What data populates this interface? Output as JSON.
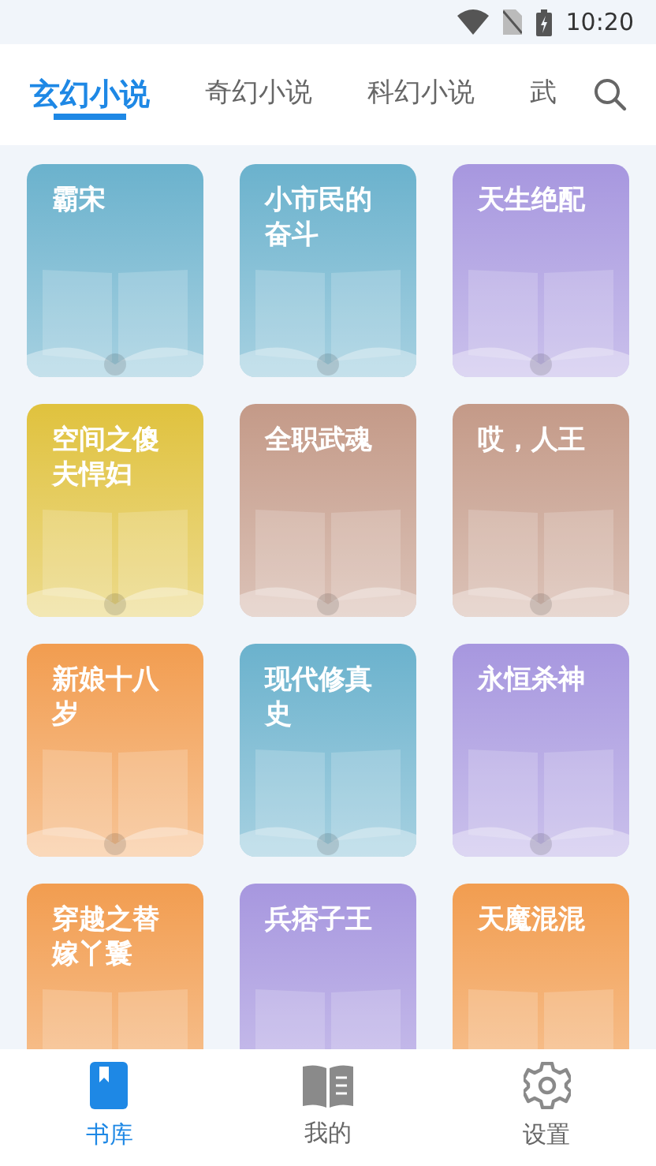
{
  "status_bar": {
    "time": "10:20"
  },
  "tabs": [
    {
      "label": "玄幻小说",
      "selected": true
    },
    {
      "label": "奇幻小说",
      "selected": false
    },
    {
      "label": "科幻小说",
      "selected": false
    },
    {
      "label": "武",
      "selected": false
    }
  ],
  "books": [
    {
      "title": "霸宋",
      "color": "#6bb2cd"
    },
    {
      "title": "小市民的奋斗",
      "color": "#6bb2cd"
    },
    {
      "title": "天生绝配",
      "color": "#a797df"
    },
    {
      "title": "空间之傻夫悍妇",
      "color": "#e0c23e"
    },
    {
      "title": "全职武魂",
      "color": "#c49a88"
    },
    {
      "title": "哎，人王",
      "color": "#c49a88"
    },
    {
      "title": "新娘十八岁",
      "color": "#f29d50"
    },
    {
      "title": "现代修真史",
      "color": "#6bb2cd"
    },
    {
      "title": "永恒杀神",
      "color": "#a797df"
    },
    {
      "title": "穿越之替嫁丫鬟",
      "color": "#f29d50"
    },
    {
      "title": "兵痞子王",
      "color": "#a797df"
    },
    {
      "title": "天魔混混",
      "color": "#f29d50"
    }
  ],
  "nav": [
    {
      "label": "书库",
      "kind": "library",
      "selected": true
    },
    {
      "label": "我的",
      "kind": "mine",
      "selected": false
    },
    {
      "label": "设置",
      "kind": "settings",
      "selected": false
    }
  ]
}
